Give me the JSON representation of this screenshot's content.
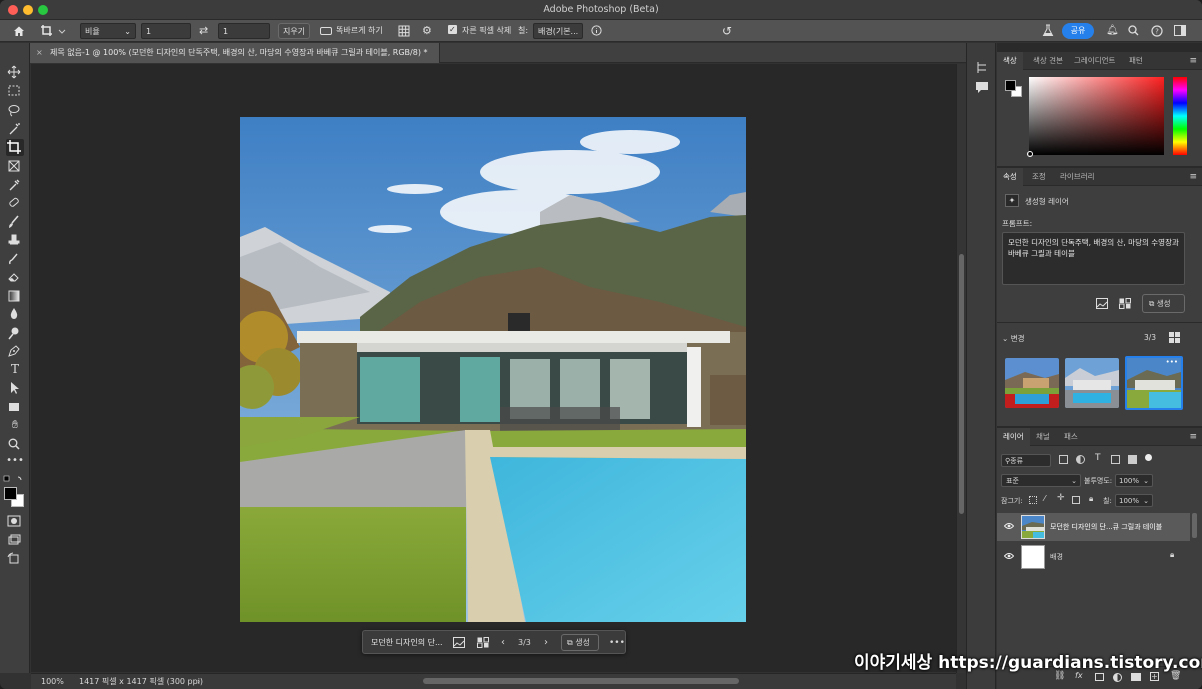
{
  "app": {
    "title": "Adobe Photoshop (Beta)"
  },
  "options_bar": {
    "ratio_select": "비율",
    "width_value": "1",
    "height_value": "1",
    "clear_label": "지우기",
    "straighten_label": "똑바르게 하기",
    "delete_cropped_label": "자른 픽셀 삭제",
    "fill_label": "칠:",
    "fill_select": "배경(기본...",
    "share_label": "공유"
  },
  "document": {
    "tab_title": "제목 없음-1 @ 100% (모던한 디자인의 단독주택, 배경의 산, 마당의 수영장과 바베큐 그릴과 테이블, RGB/8) *"
  },
  "status_bar": {
    "zoom": "100%",
    "doc_info": "1417 픽셀 x 1417 픽셀 (300 ppi)"
  },
  "context_bar": {
    "prompt_preview": "모던한 디자인의 단...",
    "counter": "3/3",
    "generate_label": "생성"
  },
  "color_panel": {
    "tabs": [
      "색상",
      "색상 견본",
      "그레이디언트",
      "패턴"
    ],
    "active_tab": 0,
    "accent_color": "#ff2020"
  },
  "properties_panel": {
    "tabs": [
      "속성",
      "조정",
      "라이브러리"
    ],
    "active_tab": 0,
    "layer_type": "생성형 레이어",
    "prompt_label": "프롬프트:",
    "prompt_text": "모던한 디자인의 단독주택, 배경의 산, 마당의 수영장과 바베큐 그릴과 테이블",
    "generate_label": "생성",
    "variations_label": "변경",
    "variations_count": "3/3",
    "variations_selected": 3
  },
  "layers_panel": {
    "tabs": [
      "레이어",
      "채널",
      "패스"
    ],
    "active_tab": 0,
    "filter_label": "종류",
    "blend_mode": "표준",
    "opacity_label": "불투명도:",
    "opacity_value": "100%",
    "lock_label": "잠그기:",
    "fill_label": "칠:",
    "fill_value": "100%",
    "layers": [
      {
        "name": "모던한 디자인의 단...큐 그릴과 테이블",
        "selected": true
      },
      {
        "name": "배경",
        "selected": false,
        "locked": true
      }
    ]
  },
  "watermark": {
    "text": "이야기세상 https://guardians.tistory.com"
  }
}
